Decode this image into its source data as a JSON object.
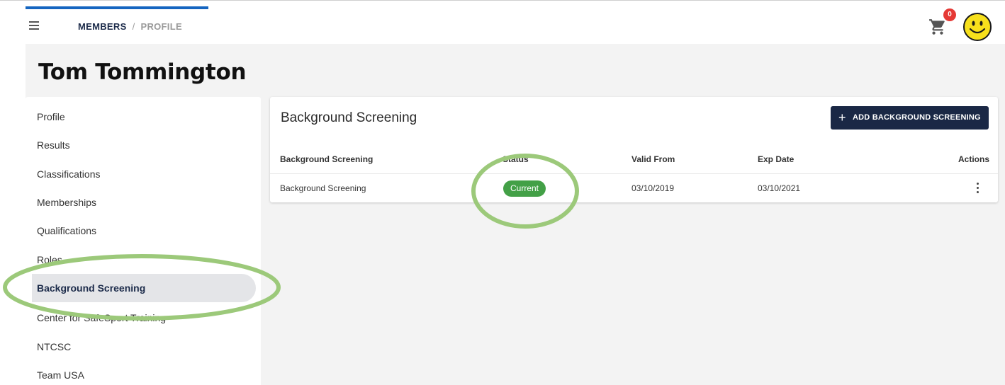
{
  "header": {
    "breadcrumb": {
      "members": "MEMBERS",
      "separator": "/",
      "profile": "PROFILE"
    },
    "cart_count": "0",
    "menu_icon": "hamburger-menu-icon",
    "cart_icon": "cart-icon",
    "avatar_icon": "smiley-face-icon"
  },
  "member": {
    "name": "Tom Tommington"
  },
  "sidebar": {
    "items": [
      {
        "label": "Profile"
      },
      {
        "label": "Results"
      },
      {
        "label": "Classifications"
      },
      {
        "label": "Memberships"
      },
      {
        "label": "Qualifications"
      },
      {
        "label": "Roles"
      },
      {
        "label": "Background Screening",
        "active": true
      },
      {
        "label": "Center for SafeSport Training"
      },
      {
        "label": "NTCSC"
      },
      {
        "label": "Team USA"
      }
    ]
  },
  "card": {
    "title": "Background Screening",
    "add_button": "ADD BACKGROUND SCREENING",
    "columns": [
      "Background Screening",
      "Status",
      "Valid From",
      "Exp Date",
      "Actions"
    ],
    "rows": [
      {
        "name": "Background Screening",
        "status": "Current",
        "valid_from": "03/10/2019",
        "exp_date": "03/10/2021"
      }
    ]
  },
  "colors": {
    "accent": "#1565c0",
    "primary_button": "#1a2845",
    "status_current": "#43a047",
    "highlight_ring": "#9cc97a",
    "badge": "#e53935"
  }
}
